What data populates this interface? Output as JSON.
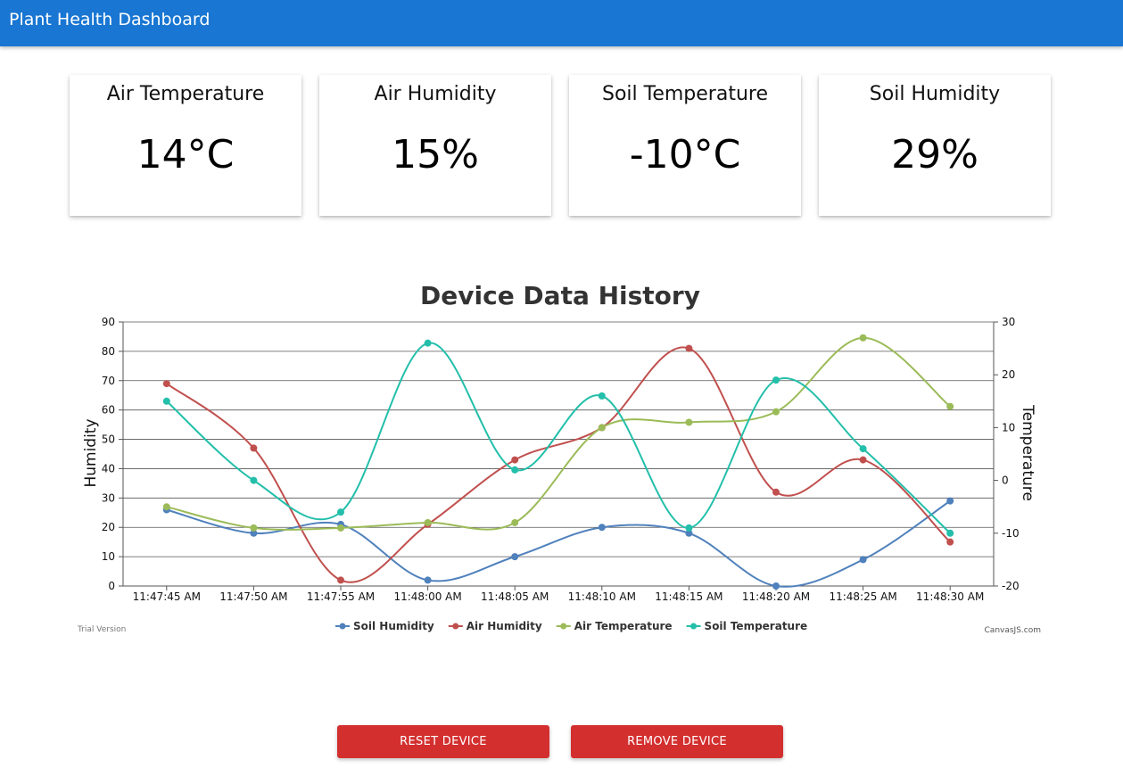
{
  "header": {
    "title": "Plant Health Dashboard"
  },
  "cards": [
    {
      "title": "Air Temperature",
      "value": "14°C"
    },
    {
      "title": "Air Humidity",
      "value": "15%"
    },
    {
      "title": "Soil Temperature",
      "value": "-10°C"
    },
    {
      "title": "Soil Humidity",
      "value": "29%"
    }
  ],
  "chart_data": {
    "type": "line",
    "title": "Device Data History",
    "ylabel": "Humidity",
    "y2label": "Temperature",
    "ylim": [
      0,
      90
    ],
    "y2lim": [
      -20,
      30
    ],
    "yticks": [
      0,
      10,
      20,
      30,
      40,
      50,
      60,
      70,
      80,
      90
    ],
    "y2ticks": [
      -20,
      -10,
      0,
      10,
      20,
      30
    ],
    "grid": true,
    "legend": "bottom",
    "categories": [
      "11:47:45 AM",
      "11:47:50 AM",
      "11:47:55 AM",
      "11:48:00 AM",
      "11:48:05 AM",
      "11:48:10 AM",
      "11:48:15 AM",
      "11:48:20 AM",
      "11:48:25 AM",
      "11:48:30 AM"
    ],
    "series": [
      {
        "name": "Soil Humidity",
        "axis": "y",
        "color": "#4f81bc",
        "values": [
          26,
          18,
          21,
          2,
          10,
          20,
          18,
          0,
          9,
          29
        ]
      },
      {
        "name": "Air Humidity",
        "axis": "y",
        "color": "#c0504e",
        "values": [
          69,
          47,
          2,
          21,
          43,
          54,
          81,
          32,
          43,
          15
        ]
      },
      {
        "name": "Air Temperature",
        "axis": "y2",
        "color": "#9bbb58",
        "values": [
          -5,
          -9,
          -9,
          -8,
          -8,
          10,
          11,
          13,
          27,
          14
        ]
      },
      {
        "name": "Soil Temperature",
        "axis": "y2",
        "color": "#23bfaa",
        "values": [
          15,
          0,
          -6,
          26,
          2,
          16,
          -9,
          19,
          6,
          -10
        ]
      }
    ],
    "watermark_left": "Trial Version",
    "watermark_right": "CanvasJS.com"
  },
  "actions": {
    "reset_label": "RESET DEVICE",
    "remove_label": "REMOVE DEVICE"
  },
  "colors": {
    "appbar": "#1976d2",
    "button": "#d32f2f"
  }
}
